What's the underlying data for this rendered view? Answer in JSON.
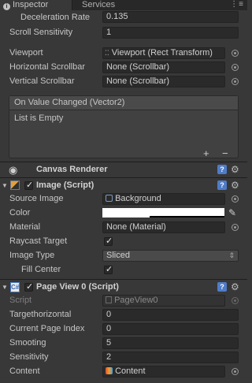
{
  "tabs": [
    {
      "label": "Inspector"
    },
    {
      "label": "Services"
    }
  ],
  "scroll_rect_fields": {
    "deceleration_rate": {
      "label": "Deceleration Rate",
      "value": "0.135"
    },
    "scroll_sensitivity": {
      "label": "Scroll Sensitivity",
      "value": "1"
    },
    "viewport": {
      "label": "Viewport",
      "value": "Viewport (Rect Transform)"
    },
    "horizontal_scrollbar": {
      "label": "Horizontal Scrollbar",
      "value": "None (Scrollbar)"
    },
    "vertical_scrollbar": {
      "label": "Vertical Scrollbar",
      "value": "None (Scrollbar)"
    }
  },
  "on_value_changed": {
    "header": "On Value Changed (Vector2)",
    "empty_text": "List is Empty",
    "add_label": "+",
    "remove_label": "−"
  },
  "canvas_renderer": {
    "title": "Canvas Renderer"
  },
  "image": {
    "title": "Image (Script)",
    "enabled": true,
    "source_image": {
      "label": "Source Image",
      "value": "Background"
    },
    "color": {
      "label": "Color",
      "value": "#ffffff"
    },
    "material": {
      "label": "Material",
      "value": "None (Material)"
    },
    "raycast_target": {
      "label": "Raycast Target",
      "checked": true
    },
    "image_type": {
      "label": "Image Type",
      "value": "Sliced"
    },
    "fill_center": {
      "label": "Fill Center",
      "checked": true
    }
  },
  "page_view": {
    "title": "Page View 0 (Script)",
    "enabled": true,
    "script": {
      "label": "Script",
      "value": "PageView0"
    },
    "target_horizontal": {
      "label": "Targethorizontal",
      "value": "0"
    },
    "current_page_index": {
      "label": "Current Page Index",
      "value": "0"
    },
    "smooting": {
      "label": "Smooting",
      "value": "5"
    },
    "sensitivity": {
      "label": "Sensitivity",
      "value": "2"
    },
    "content": {
      "label": "Content",
      "value": "Content"
    }
  }
}
